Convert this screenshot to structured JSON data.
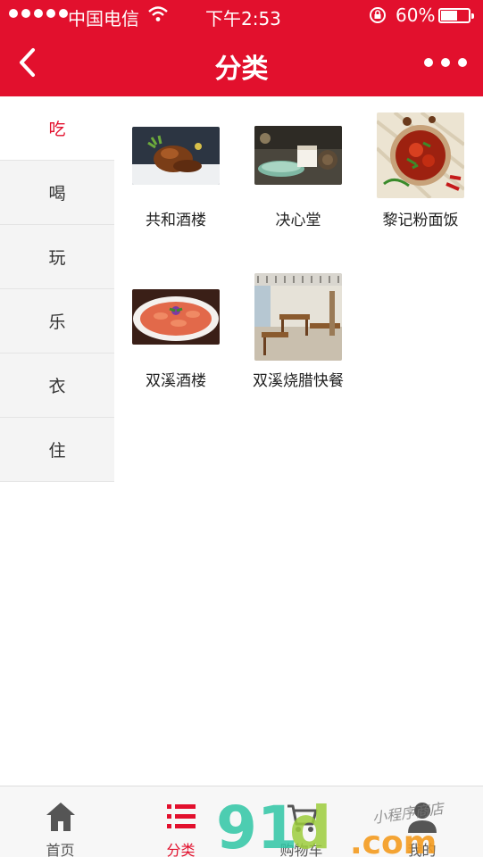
{
  "status_bar": {
    "carrier": "中国电信",
    "time": "下午2:53",
    "battery": "60%",
    "battery_level": 0.6
  },
  "header": {
    "title": "分类",
    "back_icon": "chevron-left-icon",
    "more_icon": "more-dots-icon"
  },
  "sidebar": {
    "items": [
      {
        "label": "吃",
        "active": true
      },
      {
        "label": "喝",
        "active": false
      },
      {
        "label": "玩",
        "active": false
      },
      {
        "label": "乐",
        "active": false
      },
      {
        "label": "衣",
        "active": false
      },
      {
        "label": "住",
        "active": false
      }
    ]
  },
  "stores": [
    {
      "name": "共和酒楼",
      "image": "roast-duck-dish"
    },
    {
      "name": "决心堂",
      "image": "cake-on-plate"
    },
    {
      "name": "黎记粉面饭",
      "image": "spicy-noodle-bowl"
    },
    {
      "name": "双溪酒楼",
      "image": "shrimp-platter"
    },
    {
      "name": "双溪烧腊快餐",
      "image": "restaurant-interior"
    }
  ],
  "tabbar": {
    "items": [
      {
        "label": "首页",
        "icon": "home-icon",
        "active": false
      },
      {
        "label": "分类",
        "icon": "list-icon",
        "active": true
      },
      {
        "label": "购物车",
        "icon": "cart-icon",
        "active": false
      },
      {
        "label": "我的",
        "icon": "user-icon",
        "active": false
      }
    ]
  },
  "watermark": {
    "logo": "91.com",
    "tagline": "小程序商店"
  },
  "colors": {
    "brand": "#e2102d",
    "sidebar_bg": "#f4f4f4",
    "tabbar_bg": "#f7f7f7"
  }
}
